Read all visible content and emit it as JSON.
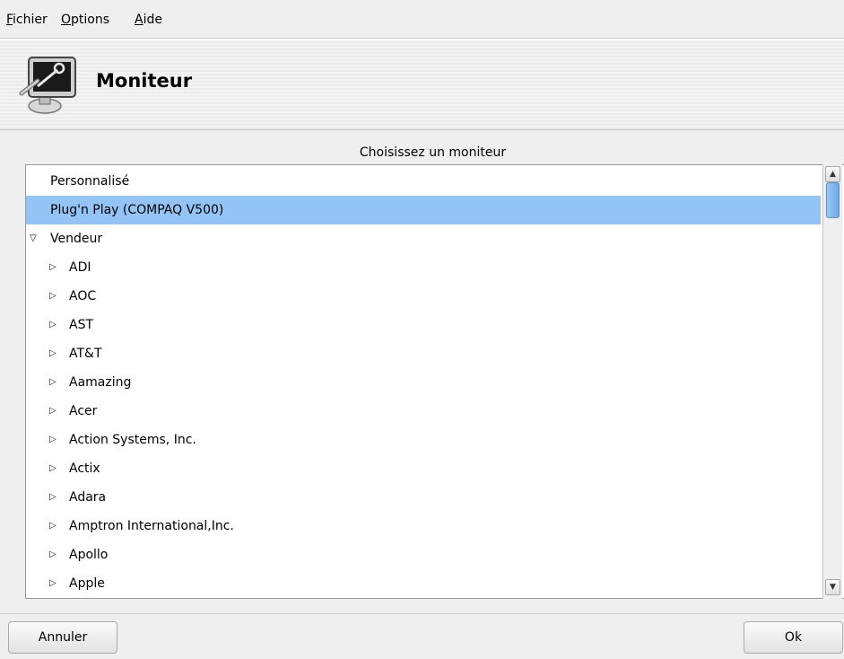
{
  "menu": {
    "items": [
      {
        "mnemonic": "F",
        "rest": "ichier"
      },
      {
        "mnemonic": "O",
        "rest": "ptions"
      },
      {
        "mnemonic": "A",
        "rest": "ide"
      }
    ]
  },
  "header": {
    "title": "Moniteur",
    "icon": "monitor-wrench-icon"
  },
  "monitor_list": {
    "caption": "Choisissez un moniteur",
    "items": [
      {
        "label": "Personnalisé",
        "level": 0,
        "expander": "none",
        "selected": false
      },
      {
        "label": "Plug'n Play (COMPAQ V500)",
        "level": 0,
        "expander": "none",
        "selected": true
      },
      {
        "label": "Vendeur",
        "level": 0,
        "expander": "expanded",
        "selected": false
      },
      {
        "label": "ADI",
        "level": 1,
        "expander": "collapsed",
        "selected": false
      },
      {
        "label": "AOC",
        "level": 1,
        "expander": "collapsed",
        "selected": false
      },
      {
        "label": "AST",
        "level": 1,
        "expander": "collapsed",
        "selected": false
      },
      {
        "label": "AT&T",
        "level": 1,
        "expander": "collapsed",
        "selected": false
      },
      {
        "label": "Aamazing",
        "level": 1,
        "expander": "collapsed",
        "selected": false
      },
      {
        "label": "Acer",
        "level": 1,
        "expander": "collapsed",
        "selected": false
      },
      {
        "label": "Action Systems, Inc.",
        "level": 1,
        "expander": "collapsed",
        "selected": false
      },
      {
        "label": "Actix",
        "level": 1,
        "expander": "collapsed",
        "selected": false
      },
      {
        "label": "Adara",
        "level": 1,
        "expander": "collapsed",
        "selected": false
      },
      {
        "label": "Amptron International,Inc.",
        "level": 1,
        "expander": "collapsed",
        "selected": false
      },
      {
        "label": "Apollo",
        "level": 1,
        "expander": "collapsed",
        "selected": false
      },
      {
        "label": "Apple",
        "level": 1,
        "expander": "collapsed",
        "selected": false
      }
    ]
  },
  "buttons": {
    "cancel_label": "Annuler",
    "ok_label": "Ok"
  },
  "colors": {
    "selection": "#94c4f6",
    "scroll_thumb": "#6fa8e6"
  }
}
